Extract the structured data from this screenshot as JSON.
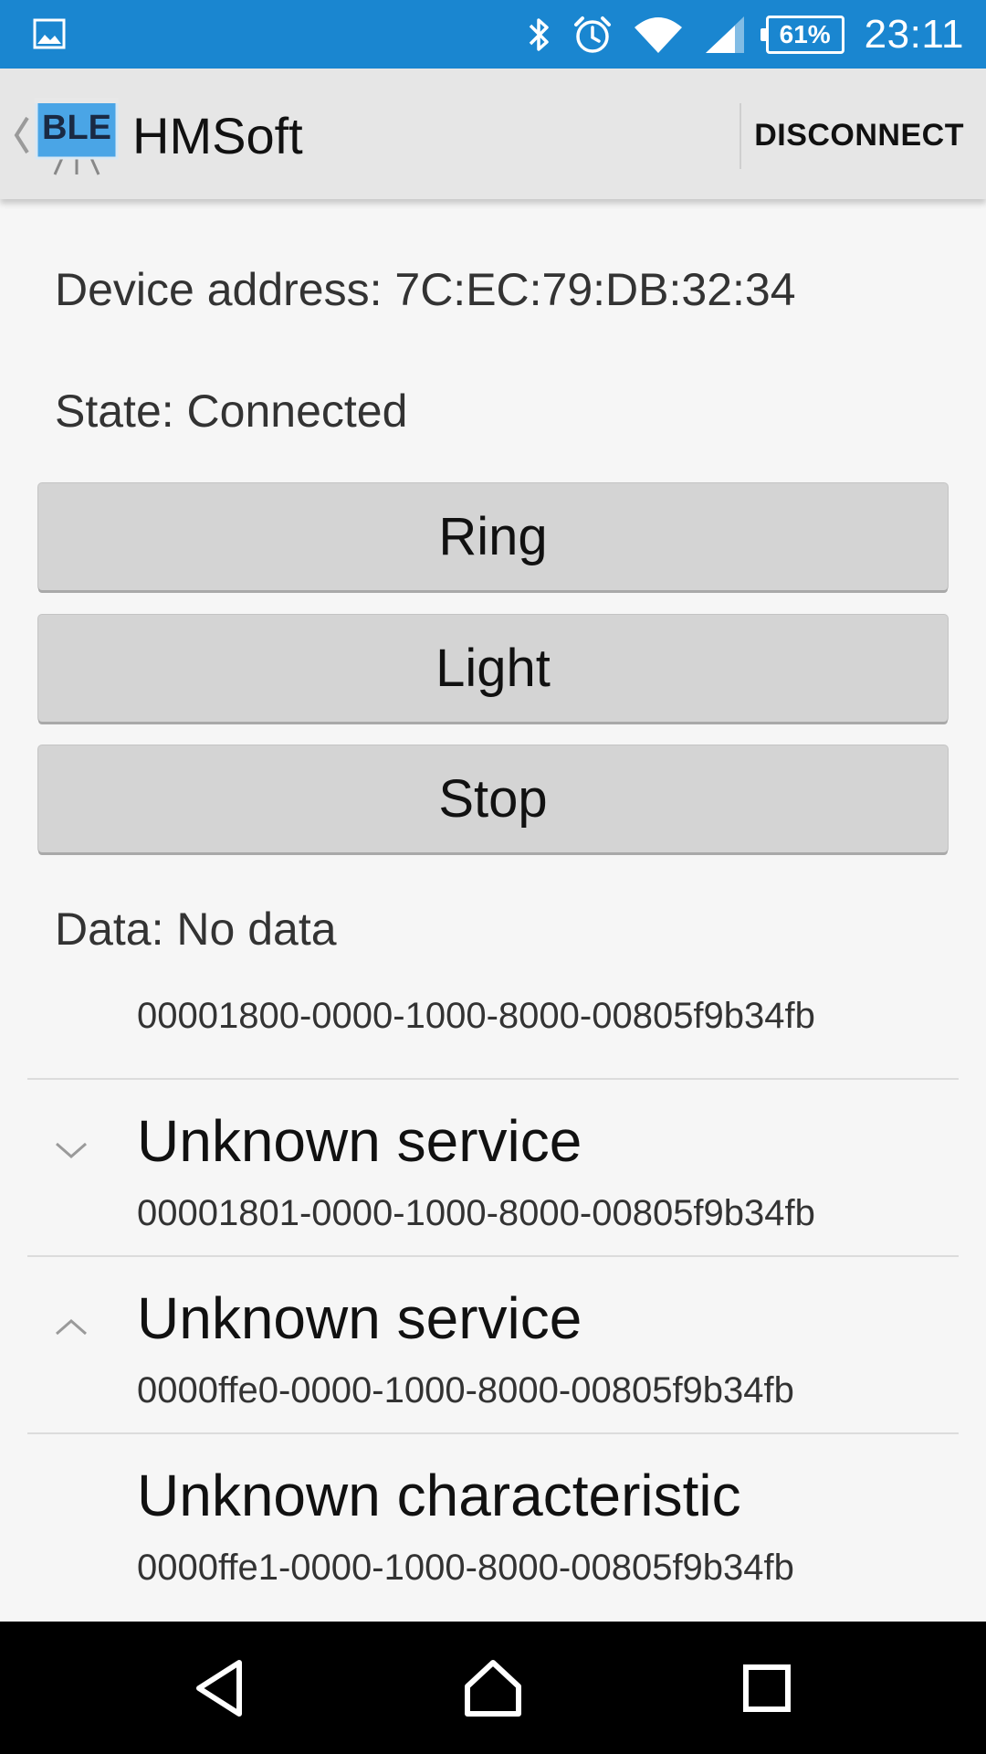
{
  "status_bar": {
    "time": "23:11",
    "battery_percent": "61%",
    "icons": [
      "gallery-icon",
      "bluetooth-icon",
      "alarm-icon",
      "wifi-icon",
      "signal-icon",
      "battery-icon"
    ]
  },
  "action_bar": {
    "app_icon_text": "BLE",
    "title": "HMSoft",
    "disconnect_label": "DISCONNECT"
  },
  "device": {
    "address_line": "Device address: 7C:EC:79:DB:32:34",
    "state_line": "State: Connected",
    "data_line": "Data: No data"
  },
  "buttons": {
    "ring": "Ring",
    "light": "Light",
    "stop": "Stop"
  },
  "services": [
    {
      "uuid": "00001800-0000-1000-8000-00805f9b34fb"
    },
    {
      "title": "Unknown service",
      "uuid": "00001801-0000-1000-8000-00805f9b34fb",
      "expanded": false
    },
    {
      "title": "Unknown service",
      "uuid": "0000ffe0-0000-1000-8000-00805f9b34fb",
      "expanded": true
    },
    {
      "title": "Unknown characteristic",
      "uuid": "0000ffe1-0000-1000-8000-00805f9b34fb"
    }
  ],
  "colors": {
    "status_bar": "#1a86d0",
    "action_bar": "#e6e6e6",
    "button": "#d4d4d4",
    "nav_bar": "#000000"
  }
}
